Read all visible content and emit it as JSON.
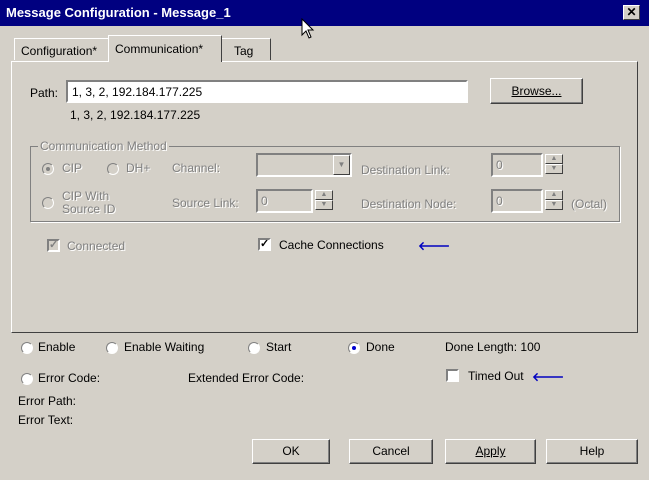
{
  "window": {
    "title": "Message Configuration - Message_1",
    "close_glyph": "✕"
  },
  "tabs": [
    {
      "label": "Configuration*"
    },
    {
      "label": "Communication*"
    },
    {
      "label": "Tag"
    }
  ],
  "path": {
    "label": "Path:",
    "value": "1, 3, 2, 192.184.177.225",
    "resolved": "1, 3, 2, 192.184.177.225",
    "browse_label": "Browse..."
  },
  "comm_method": {
    "legend": "Communication Method",
    "cip": "CIP",
    "dhplus": "DH+",
    "channel": "Channel:",
    "dest_link": "Destination Link:",
    "dest_link_value": "0",
    "cip_source_id_line1": "CIP With",
    "cip_source_id_line2": "Source ID",
    "source_link": "Source Link:",
    "source_link_value": "0",
    "dest_node": "Destination Node:",
    "dest_node_value": "0",
    "octal": "(Octal)"
  },
  "connected_label": "Connected",
  "cache_connections_label": "Cache Connections",
  "status": {
    "enable": "Enable",
    "enable_waiting": "Enable Waiting",
    "start": "Start",
    "done": "Done",
    "done_length": "Done Length: 100",
    "error_code": "Error Code:",
    "extended_error_code": "Extended Error Code:",
    "timed_out": "Timed Out",
    "error_path": "Error Path:",
    "error_text": "Error Text:"
  },
  "buttons": {
    "ok": "OK",
    "cancel": "Cancel",
    "apply": "Apply",
    "help": "Help"
  },
  "colors": {
    "titlebar": "#000080",
    "face": "#d4d0c8",
    "arrow": "#0000c0"
  }
}
